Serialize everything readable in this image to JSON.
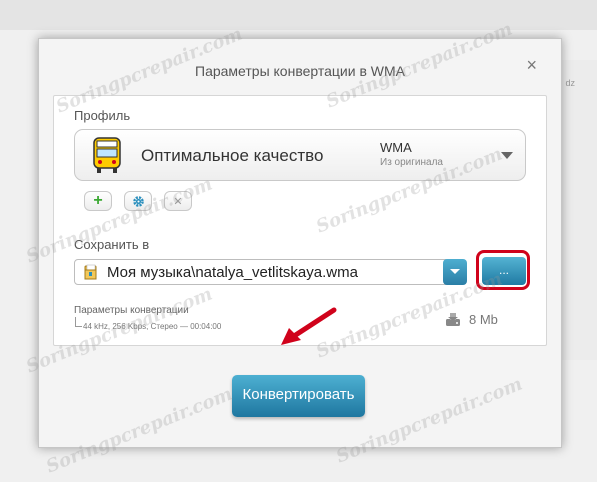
{
  "dialog": {
    "title": "Параметры конвертации в WMA",
    "close_glyph": "×"
  },
  "background": {
    "right_label": "dz"
  },
  "profile": {
    "label": "Профиль",
    "name": "Оптимальное качество",
    "format": "WMA",
    "format_sub": "Из оригинала",
    "icon": "bus-icon"
  },
  "actions": {
    "add_glyph": "+",
    "settings_icon": "gear-icon",
    "delete_glyph": "✕"
  },
  "save": {
    "label": "Сохранить в",
    "path": "Моя музыка\\natalya_vetlitskaya.wma",
    "browse_label": "..."
  },
  "conversion": {
    "label": "Параметры конвертации",
    "details": "44 kHz, 256 Kbps, Стерео — 00:04:00",
    "size": "8 Mb"
  },
  "convert_button": "Конвертировать",
  "watermark": "Soringpcrepair.com",
  "colors": {
    "accent": "#2a8fbd",
    "highlight": "#d0021b",
    "add_green": "#3aa832"
  }
}
